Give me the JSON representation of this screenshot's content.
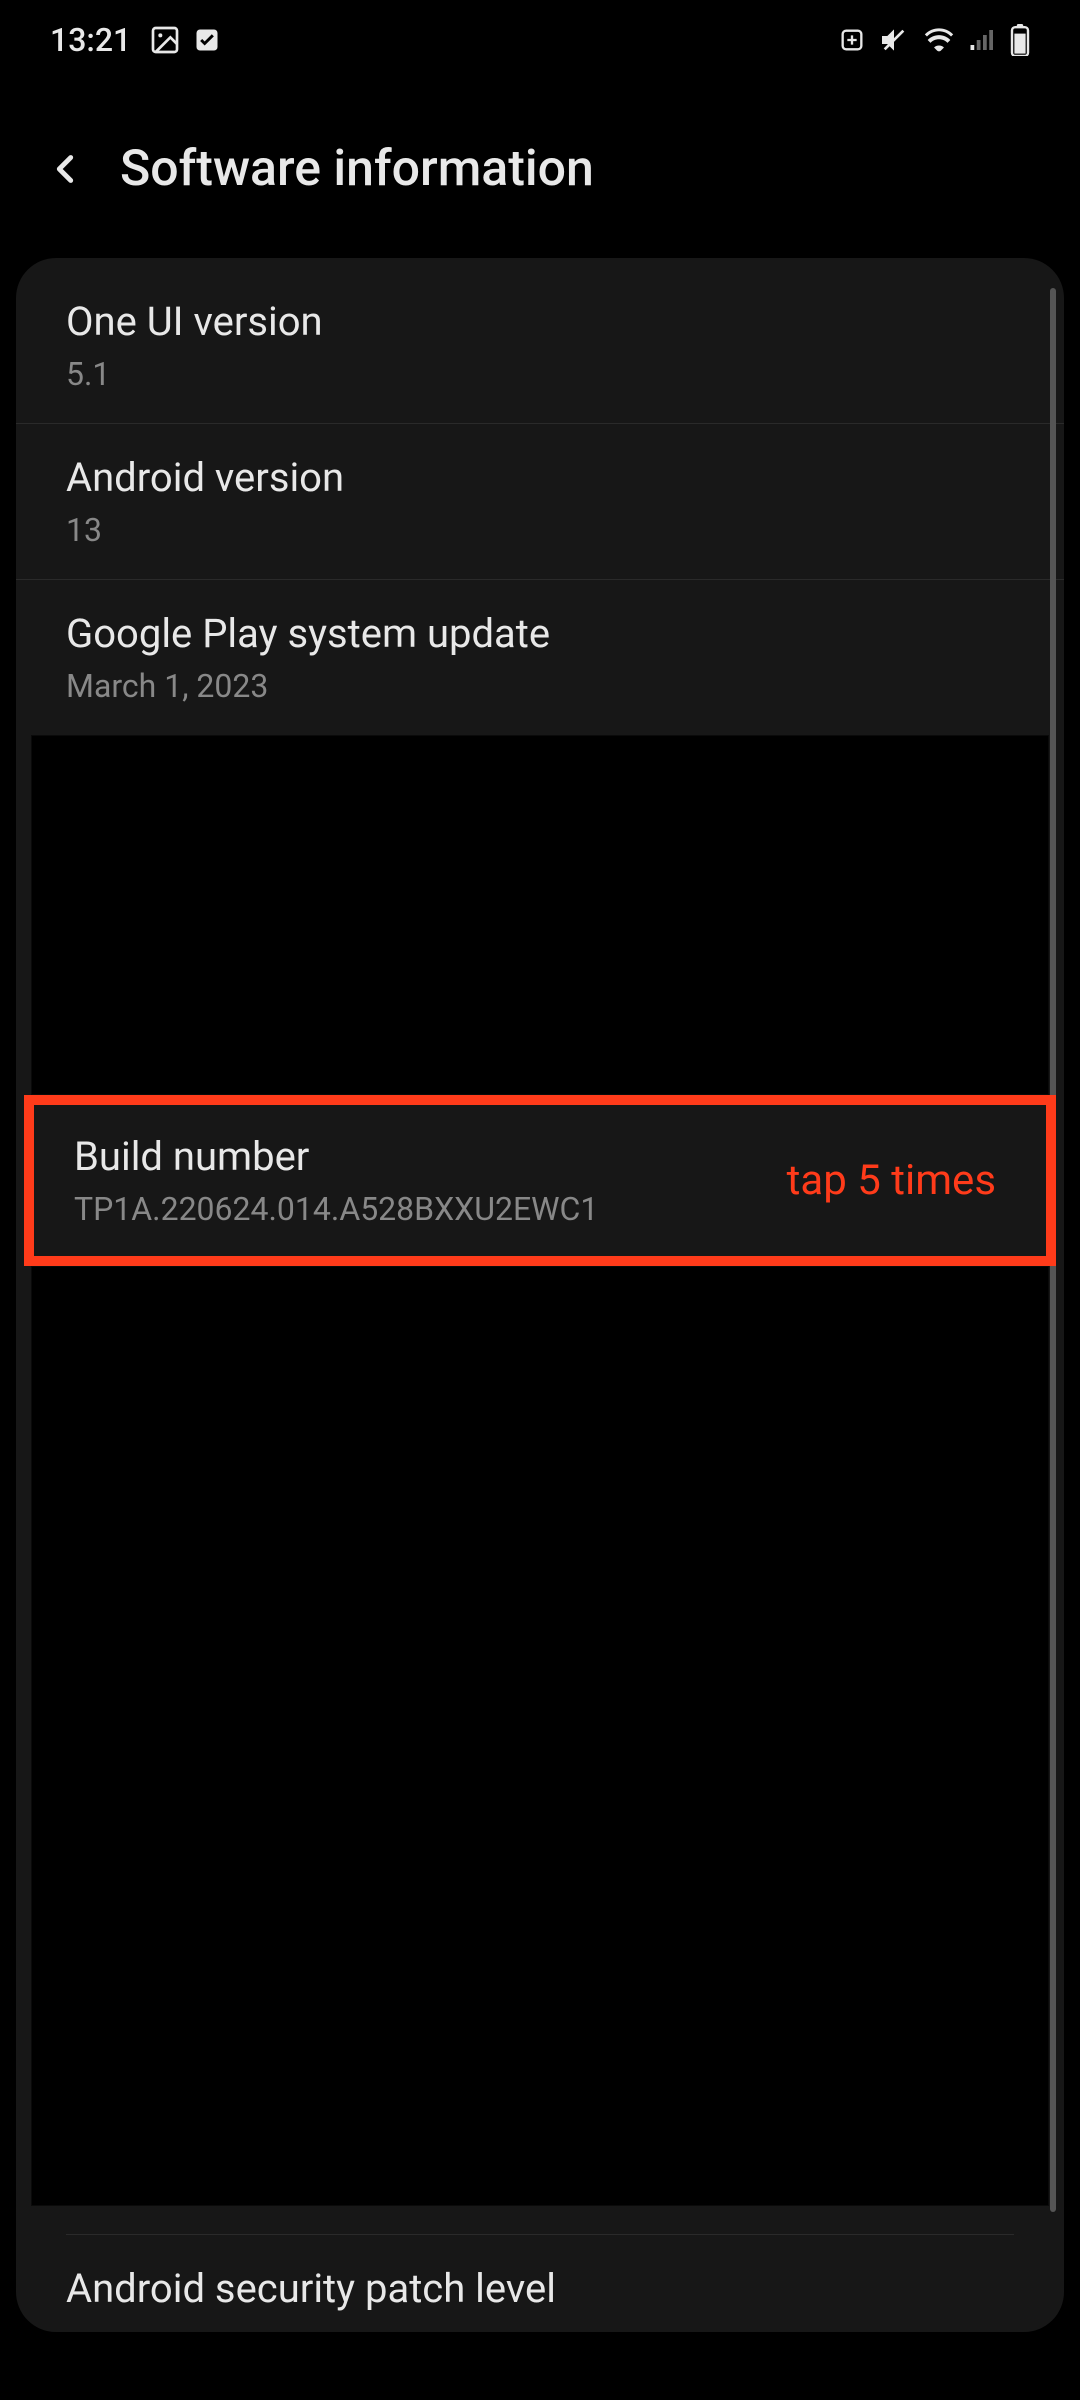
{
  "status": {
    "time": "13:21"
  },
  "header": {
    "title": "Software information"
  },
  "items": {
    "one_ui": {
      "title": "One UI version",
      "value": "5.1"
    },
    "android": {
      "title": "Android version",
      "value": "13"
    },
    "gplay": {
      "title": "Google Play system update",
      "value": "March 1, 2023"
    },
    "build": {
      "title": "Build number",
      "value": "TP1A.220624.014.A528BXXU2EWC1"
    },
    "security": {
      "title": "Android security patch level"
    }
  },
  "annotation": {
    "build_tap": "tap 5 times"
  },
  "colors": {
    "highlight": "#ff3b1a"
  }
}
